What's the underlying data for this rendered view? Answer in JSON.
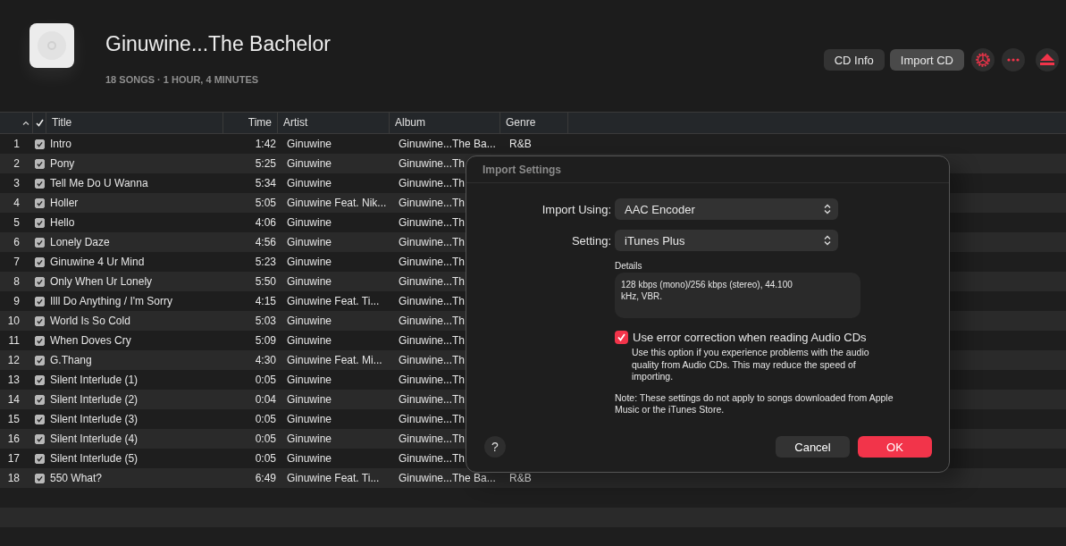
{
  "album": {
    "title": "Ginuwine...The Bachelor",
    "subtitle": "18 SONGS · 1 HOUR, 4 MINUTES"
  },
  "actions": [
    {
      "label": "CD Info",
      "selected": false
    },
    {
      "label": "Import CD",
      "selected": true
    }
  ],
  "table": {
    "columns": [
      {
        "label": "Title",
        "kind": "title"
      },
      {
        "label": "Time",
        "kind": "time"
      },
      {
        "label": "Artist",
        "kind": "artist"
      },
      {
        "label": "Album",
        "kind": "album"
      },
      {
        "label": "Genre",
        "kind": "genre"
      }
    ],
    "rows": [
      {
        "number": "1",
        "checked": true,
        "title": "Intro",
        "time": "1:42",
        "artist": "Ginuwine",
        "album": "Ginuwine...The Ba...",
        "genre": "R&B"
      },
      {
        "number": "2",
        "checked": true,
        "title": "Pony",
        "time": "5:25",
        "artist": "Ginuwine",
        "album": "Ginuwine...Th"
      },
      {
        "number": "3",
        "checked": true,
        "title": "Tell Me Do U Wanna",
        "time": "5:34",
        "artist": "Ginuwine",
        "album": "Ginuwine...Th"
      },
      {
        "number": "4",
        "checked": true,
        "title": "Holler",
        "time": "5:05",
        "artist": "Ginuwine Feat. Nik...",
        "album": "Ginuwine...Th"
      },
      {
        "number": "5",
        "checked": true,
        "title": "Hello",
        "time": "4:06",
        "artist": "Ginuwine",
        "album": "Ginuwine...Th"
      },
      {
        "number": "6",
        "checked": true,
        "title": "Lonely Daze",
        "time": "4:56",
        "artist": "Ginuwine",
        "album": "Ginuwine...Th"
      },
      {
        "number": "7",
        "checked": true,
        "title": "Ginuwine 4 Ur Mind",
        "time": "5:23",
        "artist": "Ginuwine",
        "album": "Ginuwine...Th"
      },
      {
        "number": "8",
        "checked": true,
        "title": "Only When Ur Lonely",
        "time": "5:50",
        "artist": "Ginuwine",
        "album": "Ginuwine...Th"
      },
      {
        "number": "9",
        "checked": true,
        "title": "Illl Do Anything / I'm Sorry",
        "time": "4:15",
        "artist": "Ginuwine Feat. Ti...",
        "album": "Ginuwine...Th"
      },
      {
        "number": "10",
        "checked": true,
        "title": "World Is So Cold",
        "time": "5:03",
        "artist": "Ginuwine",
        "album": "Ginuwine...Th"
      },
      {
        "number": "11",
        "checked": true,
        "title": "When Doves Cry",
        "time": "5:09",
        "artist": "Ginuwine",
        "album": "Ginuwine...Th"
      },
      {
        "number": "12",
        "checked": true,
        "title": "G.Thang",
        "time": "4:30",
        "artist": "Ginuwine Feat. Mi...",
        "album": "Ginuwine...Th"
      },
      {
        "number": "13",
        "checked": true,
        "title": "Silent Interlude (1)",
        "time": "0:05",
        "artist": "Ginuwine",
        "album": "Ginuwine...Th"
      },
      {
        "number": "14",
        "checked": true,
        "title": "Silent Interlude (2)",
        "time": "0:04",
        "artist": "Ginuwine",
        "album": "Ginuwine...Th"
      },
      {
        "number": "15",
        "checked": true,
        "title": "Silent Interlude (3)",
        "time": "0:05",
        "artist": "Ginuwine",
        "album": "Ginuwine...Th"
      },
      {
        "number": "16",
        "checked": true,
        "title": "Silent Interlude (4)",
        "time": "0:05",
        "artist": "Ginuwine",
        "album": "Ginuwine...Th"
      },
      {
        "number": "17",
        "checked": true,
        "title": "Silent Interlude (5)",
        "time": "0:05",
        "artist": "Ginuwine",
        "album": "Ginuwine...Th"
      },
      {
        "number": "18",
        "checked": true,
        "title": "550 What?",
        "time": "6:49",
        "artist": "Ginuwine Feat. Ti...",
        "album": "Ginuwine...The Ba...",
        "genre": "R&B"
      }
    ]
  },
  "dialog": {
    "title": "Import Settings",
    "fields": [
      {
        "label": "Import Using:",
        "value": "AAC Encoder"
      },
      {
        "label": "Setting:",
        "value": "iTunes Plus"
      }
    ],
    "details_label": "Details",
    "details": "128 kbps (mono)/256 kbps (stereo), 44.100 kHz, VBR.",
    "error_correction": {
      "label": "Use error correction when reading Audio CDs",
      "checked": true,
      "description": "Use this option if you experience problems with the audio quality from Audio CDs. This may reduce the speed of importing."
    },
    "note": "Note: These settings do not apply to songs downloaded from Apple Music or the iTunes Store.",
    "help": "?",
    "buttons": [
      {
        "label": "Cancel",
        "kind": "secondary"
      },
      {
        "label": "OK",
        "kind": "primary"
      }
    ]
  }
}
